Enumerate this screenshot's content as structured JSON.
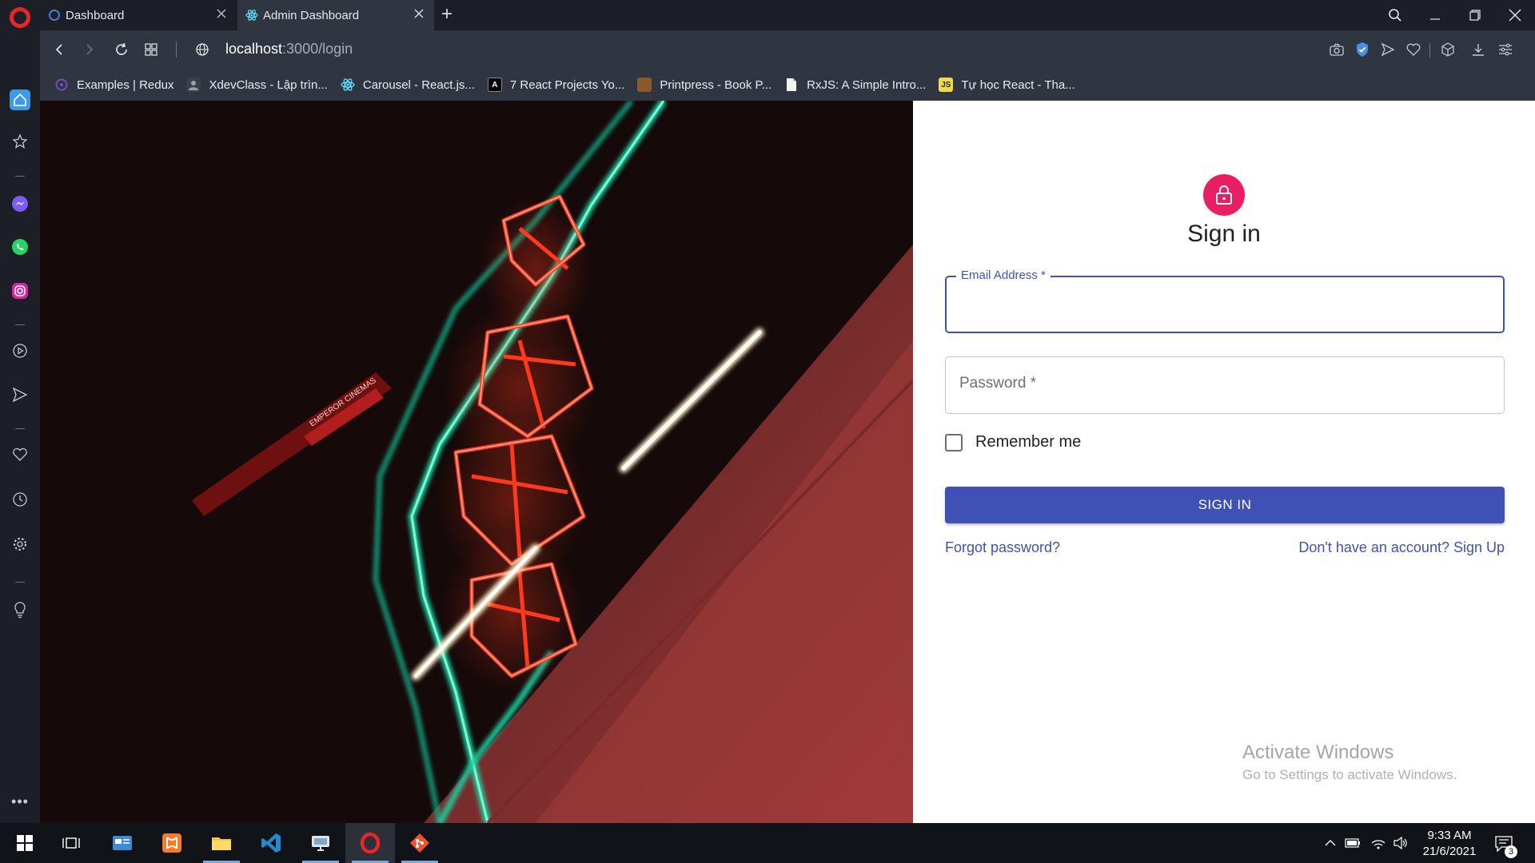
{
  "browser": {
    "tabs": [
      {
        "title": "Dashboard",
        "active": false
      },
      {
        "title": "Admin Dashboard",
        "active": true
      }
    ],
    "url": {
      "host": "localhost",
      "path": ":3000/login"
    },
    "bookmarks": [
      {
        "label": "Examples | Redux",
        "icon": "redux-icon",
        "color": "#764abc"
      },
      {
        "label": "XdevClass - Lập trìn...",
        "icon": "xdev-icon",
        "color": "#555a63"
      },
      {
        "label": "Carousel - React.js...",
        "icon": "react-icon",
        "color": "#61dafb"
      },
      {
        "label": "7 React Projects Yo...",
        "icon": "codepen-icon",
        "color": "#000000"
      },
      {
        "label": "Printpress - Book P...",
        "icon": "printpress-icon",
        "color": "#a0522d"
      },
      {
        "label": "RxJS: A Simple Intro...",
        "icon": "document-icon",
        "color": "#ffffff"
      },
      {
        "label": "Tự học React - Tha...",
        "icon": "js-icon",
        "color": "#f0db4f"
      }
    ]
  },
  "signin": {
    "title": "Sign in",
    "email_label": "Email Address *",
    "password_label": "Password *",
    "remember_label": "Remember me",
    "button_label": "SIGN IN",
    "forgot_link": "Forgot password?",
    "signup_link": "Don't have an account? Sign Up",
    "accent_color": "#3f51b5",
    "avatar_color": "#e91e63"
  },
  "hero": {
    "sign_text": "EMPEROR CINEMAS"
  },
  "watermark": {
    "line1": "Activate Windows",
    "line2": "Go to Settings to activate Windows."
  },
  "taskbar": {
    "time": "9:33 AM",
    "date": "21/6/2021",
    "notifications": "3"
  }
}
